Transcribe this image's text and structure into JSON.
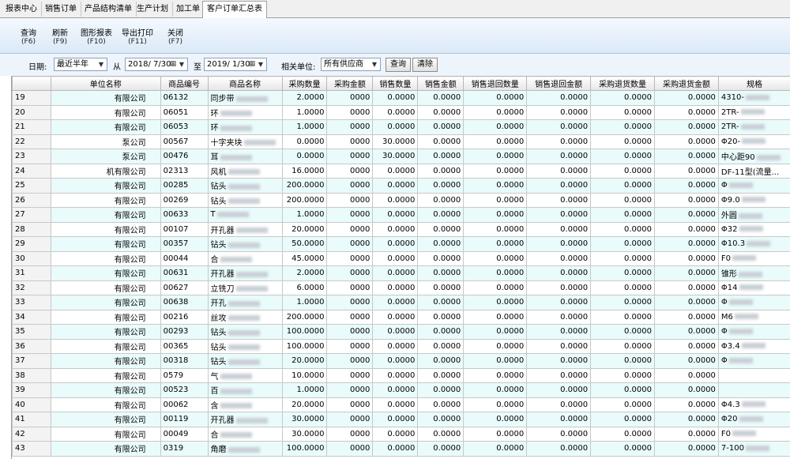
{
  "tabs": [
    "报表中心",
    "销售订单",
    "产品结构清单",
    "生产计划",
    "加工单",
    "客户订单汇总表"
  ],
  "toolbar": [
    {
      "label": "查询",
      "key": "(F6)"
    },
    {
      "label": "刷新",
      "key": "(F9)"
    },
    {
      "label": "图形报表",
      "key": "(F10)"
    },
    {
      "label": "导出打印",
      "key": "(F11)"
    },
    {
      "label": "关闭",
      "key": "(F7)"
    }
  ],
  "filter": {
    "date_label": "日期:",
    "range_value": "最近半年",
    "from_label": "从",
    "from_value": "2018/ 7/30",
    "to_label": "至",
    "to_value": "2019/ 1/30",
    "unit_label": "相关单位:",
    "unit_value": "所有供应商",
    "query_label": "查询",
    "clear_label": "清除"
  },
  "columns": [
    "单位名称",
    "商品编号",
    "商品名称",
    "采购数量",
    "采购金额",
    "销售数量",
    "销售金额",
    "销售退回数量",
    "销售退回金额",
    "采购退货数量",
    "采购退货金额",
    "规格"
  ],
  "rows": [
    {
      "idx": "19",
      "company": "有限公司",
      "code": "06132",
      "name": "同步带",
      "q": "2.0000",
      "a": "0000",
      "sq": "0.0000",
      "sa": "0.0000",
      "rq": "0.0000",
      "ra": "0.0000",
      "pq": "0.0000",
      "pa": "0.0000",
      "spec": "4310-"
    },
    {
      "idx": "20",
      "company": "有限公司",
      "code": "06051",
      "name": "环",
      "q": "1.0000",
      "a": "0000",
      "sq": "0.0000",
      "sa": "0.0000",
      "rq": "0.0000",
      "ra": "0.0000",
      "pq": "0.0000",
      "pa": "0.0000",
      "spec": "2TR-"
    },
    {
      "idx": "21",
      "company": "有限公司",
      "code": "06053",
      "name": "环",
      "q": "1.0000",
      "a": "0000",
      "sq": "0.0000",
      "sa": "0.0000",
      "rq": "0.0000",
      "ra": "0.0000",
      "pq": "0.0000",
      "pa": "0.0000",
      "spec": "2TR-"
    },
    {
      "idx": "22",
      "company": "泵公司",
      "code": "00567",
      "name": "十字夹块",
      "q": "0.0000",
      "a": "0000",
      "sq": "30.0000",
      "sa": "0.0000",
      "rq": "0.0000",
      "ra": "0.0000",
      "pq": "0.0000",
      "pa": "0.0000",
      "spec": "Φ20-"
    },
    {
      "idx": "23",
      "company": "泵公司",
      "code": "00476",
      "name": "耳",
      "q": "0.0000",
      "a": "0000",
      "sq": "30.0000",
      "sa": "0.0000",
      "rq": "0.0000",
      "ra": "0.0000",
      "pq": "0.0000",
      "pa": "0.0000",
      "spec": "中心距90"
    },
    {
      "idx": "24",
      "company": "机有限公司",
      "code": "02313",
      "name": "风机",
      "q": "16.0000",
      "a": "0000",
      "sq": "0.0000",
      "sa": "0.0000",
      "rq": "0.0000",
      "ra": "0.0000",
      "pq": "0.0000",
      "pa": "0.0000",
      "spec": "DF-11型(流量..."
    },
    {
      "idx": "25",
      "company": "有限公司",
      "code": "00285",
      "name": "钻头",
      "q": "200.0000",
      "a": "0000",
      "sq": "0.0000",
      "sa": "0.0000",
      "rq": "0.0000",
      "ra": "0.0000",
      "pq": "0.0000",
      "pa": "0.0000",
      "spec": "Φ"
    },
    {
      "idx": "26",
      "company": "有限公司",
      "code": "00269",
      "name": "钻头",
      "q": "200.0000",
      "a": "0000",
      "sq": "0.0000",
      "sa": "0.0000",
      "rq": "0.0000",
      "ra": "0.0000",
      "pq": "0.0000",
      "pa": "0.0000",
      "spec": "Φ9.0"
    },
    {
      "idx": "27",
      "company": "有限公司",
      "code": "00633",
      "name": "T",
      "q": "1.0000",
      "a": "0000",
      "sq": "0.0000",
      "sa": "0.0000",
      "rq": "0.0000",
      "ra": "0.0000",
      "pq": "0.0000",
      "pa": "0.0000",
      "spec": "外圆"
    },
    {
      "idx": "28",
      "company": "有限公司",
      "code": "00107",
      "name": "开孔器",
      "q": "20.0000",
      "a": "0000",
      "sq": "0.0000",
      "sa": "0.0000",
      "rq": "0.0000",
      "ra": "0.0000",
      "pq": "0.0000",
      "pa": "0.0000",
      "spec": "Φ32"
    },
    {
      "idx": "29",
      "company": "有限公司",
      "code": "00357",
      "name": "钻头",
      "q": "50.0000",
      "a": "0000",
      "sq": "0.0000",
      "sa": "0.0000",
      "rq": "0.0000",
      "ra": "0.0000",
      "pq": "0.0000",
      "pa": "0.0000",
      "spec": "Φ10.3"
    },
    {
      "idx": "30",
      "company": "有限公司",
      "code": "00044",
      "name": "合",
      "q": "45.0000",
      "a": "0000",
      "sq": "0.0000",
      "sa": "0.0000",
      "rq": "0.0000",
      "ra": "0.0000",
      "pq": "0.0000",
      "pa": "0.0000",
      "spec": "F0"
    },
    {
      "idx": "31",
      "company": "有限公司",
      "code": "00631",
      "name": "开孔器",
      "q": "2.0000",
      "a": "0000",
      "sq": "0.0000",
      "sa": "0.0000",
      "rq": "0.0000",
      "ra": "0.0000",
      "pq": "0.0000",
      "pa": "0.0000",
      "spec": "锥形"
    },
    {
      "idx": "32",
      "company": "有限公司",
      "code": "00627",
      "name": "立铣刀",
      "q": "6.0000",
      "a": "0000",
      "sq": "0.0000",
      "sa": "0.0000",
      "rq": "0.0000",
      "ra": "0.0000",
      "pq": "0.0000",
      "pa": "0.0000",
      "spec": "Φ14"
    },
    {
      "idx": "33",
      "company": "有限公司",
      "code": "00638",
      "name": "开孔",
      "q": "1.0000",
      "a": "0000",
      "sq": "0.0000",
      "sa": "0.0000",
      "rq": "0.0000",
      "ra": "0.0000",
      "pq": "0.0000",
      "pa": "0.0000",
      "spec": "Φ"
    },
    {
      "idx": "34",
      "company": "有限公司",
      "code": "00216",
      "name": "丝攻",
      "q": "200.0000",
      "a": "0000",
      "sq": "0.0000",
      "sa": "0.0000",
      "rq": "0.0000",
      "ra": "0.0000",
      "pq": "0.0000",
      "pa": "0.0000",
      "spec": "M6"
    },
    {
      "idx": "35",
      "company": "有限公司",
      "code": "00293",
      "name": "钻头",
      "q": "100.0000",
      "a": "0000",
      "sq": "0.0000",
      "sa": "0.0000",
      "rq": "0.0000",
      "ra": "0.0000",
      "pq": "0.0000",
      "pa": "0.0000",
      "spec": "Φ"
    },
    {
      "idx": "36",
      "company": "有限公司",
      "code": "00365",
      "name": "钻头",
      "q": "100.0000",
      "a": "0000",
      "sq": "0.0000",
      "sa": "0.0000",
      "rq": "0.0000",
      "ra": "0.0000",
      "pq": "0.0000",
      "pa": "0.0000",
      "spec": "Φ3.4"
    },
    {
      "idx": "37",
      "company": "有限公司",
      "code": "00318",
      "name": "钻头",
      "q": "20.0000",
      "a": "0000",
      "sq": "0.0000",
      "sa": "0.0000",
      "rq": "0.0000",
      "ra": "0.0000",
      "pq": "0.0000",
      "pa": "0.0000",
      "spec": "Φ"
    },
    {
      "idx": "38",
      "company": "有限公司",
      "code": "0579",
      "name": "气",
      "q": "10.0000",
      "a": "0000",
      "sq": "0.0000",
      "sa": "0.0000",
      "rq": "0.0000",
      "ra": "0.0000",
      "pq": "0.0000",
      "pa": "0.0000",
      "spec": ""
    },
    {
      "idx": "39",
      "company": "有限公司",
      "code": "00523",
      "name": "百",
      "q": "1.0000",
      "a": "0000",
      "sq": "0.0000",
      "sa": "0.0000",
      "rq": "0.0000",
      "ra": "0.0000",
      "pq": "0.0000",
      "pa": "0.0000",
      "spec": ""
    },
    {
      "idx": "40",
      "company": "有限公司",
      "code": "00062",
      "name": "含",
      "q": "20.0000",
      "a": "0000",
      "sq": "0.0000",
      "sa": "0.0000",
      "rq": "0.0000",
      "ra": "0.0000",
      "pq": "0.0000",
      "pa": "0.0000",
      "spec": "Φ4.3"
    },
    {
      "idx": "41",
      "company": "有限公司",
      "code": "00119",
      "name": "开孔器",
      "q": "30.0000",
      "a": "0000",
      "sq": "0.0000",
      "sa": "0.0000",
      "rq": "0.0000",
      "ra": "0.0000",
      "pq": "0.0000",
      "pa": "0.0000",
      "spec": "Φ20"
    },
    {
      "idx": "42",
      "company": "有限公司",
      "code": "00049",
      "name": "合",
      "q": "30.0000",
      "a": "0000",
      "sq": "0.0000",
      "sa": "0.0000",
      "rq": "0.0000",
      "ra": "0.0000",
      "pq": "0.0000",
      "pa": "0.0000",
      "spec": "F0"
    },
    {
      "idx": "43",
      "company": "有限公司",
      "code": "0319",
      "name": "角磨",
      "q": "100.0000",
      "a": "0000",
      "sq": "0.0000",
      "sa": "0.0000",
      "rq": "0.0000",
      "ra": "0.0000",
      "pq": "0.0000",
      "pa": "0.0000",
      "spec": "7-100"
    }
  ]
}
